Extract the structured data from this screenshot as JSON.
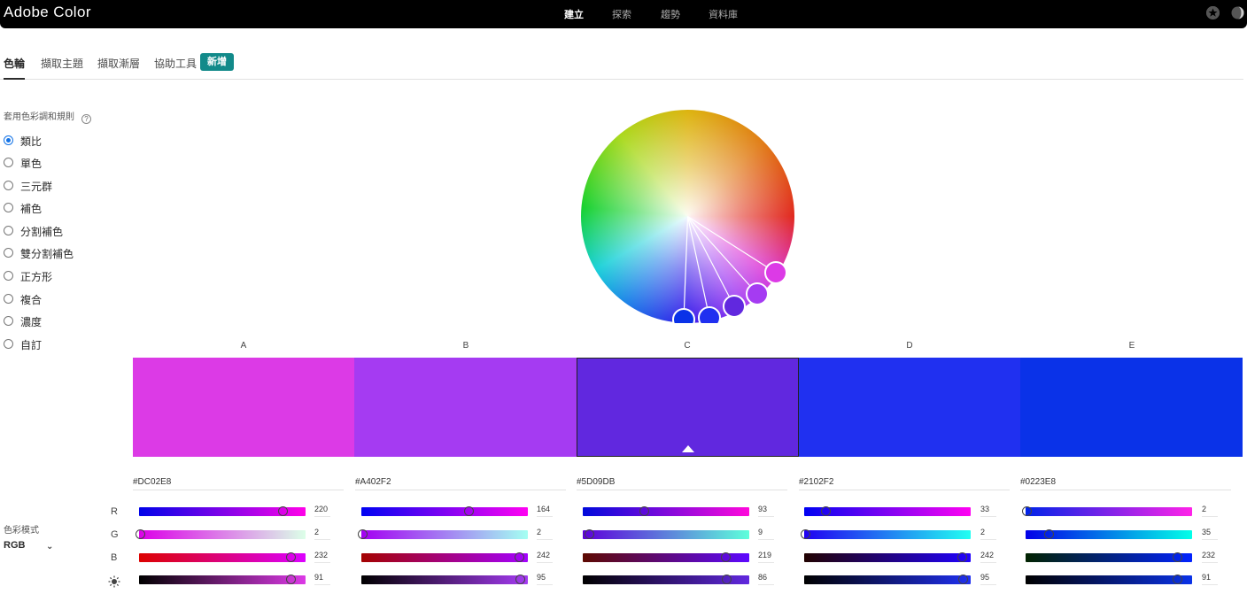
{
  "app": {
    "title": "Adobe Color",
    "nav": [
      {
        "label": "建立",
        "active": true
      },
      {
        "label": "探索",
        "active": false
      },
      {
        "label": "趨勢",
        "active": false
      },
      {
        "label": "資料庫",
        "active": false
      }
    ],
    "icons": [
      "star-icon",
      "theme-toggle-icon"
    ]
  },
  "tabs": [
    {
      "label": "色輪",
      "active": true
    },
    {
      "label": "擷取主題",
      "active": false
    },
    {
      "label": "擷取漸層",
      "active": false
    },
    {
      "label": "協助工具",
      "active": false
    }
  ],
  "new_badge": "新增",
  "rules": {
    "heading": "套用色彩調和規則",
    "help_glyph": "?",
    "options": [
      {
        "label": "類比",
        "checked": true
      },
      {
        "label": "單色",
        "checked": false
      },
      {
        "label": "三元群",
        "checked": false
      },
      {
        "label": "補色",
        "checked": false
      },
      {
        "label": "分割補色",
        "checked": false
      },
      {
        "label": "雙分割補色",
        "checked": false
      },
      {
        "label": "正方形",
        "checked": false
      },
      {
        "label": "複合",
        "checked": false
      },
      {
        "label": "濃度",
        "checked": false
      },
      {
        "label": "自訂",
        "checked": false
      }
    ]
  },
  "swatches": [
    {
      "label": "A",
      "hex": "#DC02E8",
      "color": "#DC3AE6",
      "r": 220,
      "g": 2,
      "b": 232,
      "brightness": 91,
      "selected": false
    },
    {
      "label": "B",
      "hex": "#A402F2",
      "color": "#A53BF2",
      "r": 164,
      "g": 2,
      "b": 242,
      "brightness": 95,
      "selected": false
    },
    {
      "label": "C",
      "hex": "#5D09DB",
      "color": "#6128DF",
      "r": 93,
      "g": 9,
      "b": 219,
      "brightness": 86,
      "selected": true
    },
    {
      "label": "D",
      "hex": "#2102F2",
      "color": "#2030F0",
      "r": 33,
      "g": 2,
      "b": 242,
      "brightness": 95,
      "selected": false
    },
    {
      "label": "E",
      "hex": "#0223E8",
      "color": "#0A32E8",
      "r": 2,
      "g": 35,
      "b": 232,
      "brightness": 91,
      "selected": false
    }
  ],
  "channels": [
    "R",
    "G",
    "B"
  ],
  "color_mode": {
    "label": "色彩模式",
    "value": "RGB",
    "caret": "⌄"
  }
}
